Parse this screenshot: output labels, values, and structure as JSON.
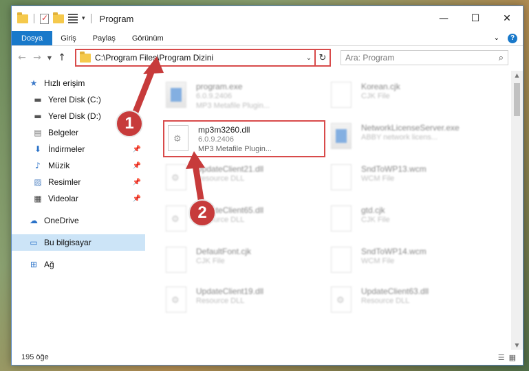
{
  "window": {
    "title": "Program",
    "min_icon": "minimize-icon",
    "max_icon": "maximize-icon",
    "close_icon": "close-icon"
  },
  "ribbon": {
    "tabs": [
      "Dosya",
      "Giriş",
      "Paylaş",
      "Görünüm"
    ],
    "active_tab": "Dosya"
  },
  "address": {
    "path": "C:\\Program Files\\Program Dizini",
    "search_placeholder": "Ara: Program"
  },
  "nav": {
    "quick_access": "Hızlı erişim",
    "items": [
      {
        "label": "Yerel Disk (C:)",
        "icon": "drive-icon",
        "pinned": false
      },
      {
        "label": "Yerel Disk (D:)",
        "icon": "drive-icon",
        "pinned": false
      },
      {
        "label": "Belgeler",
        "icon": "documents-icon",
        "pinned": false
      },
      {
        "label": "İndirmeler",
        "icon": "downloads-icon",
        "pinned": true
      },
      {
        "label": "Müzik",
        "icon": "music-icon",
        "pinned": true
      },
      {
        "label": "Resimler",
        "icon": "pictures-icon",
        "pinned": true
      },
      {
        "label": "Videolar",
        "icon": "videos-icon",
        "pinned": true
      }
    ],
    "onedrive": "OneDrive",
    "this_pc": "Bu bilgisayar",
    "network": "Ağ"
  },
  "files": [
    {
      "name": "program.exe",
      "line1": "6.0.9.2406",
      "line2": "MP3 Metafile Plugin..."
    },
    {
      "name": "Korean.cjk",
      "line1": "CJK File",
      "line2": ""
    },
    {
      "name": "mp3m3260.dll",
      "line1": "6.0.9.2406",
      "line2": "MP3 Metafile Plugin..."
    },
    {
      "name": "NetworkLicenseServer.exe",
      "line1": "ABBY network licens...",
      "line2": ""
    },
    {
      "name": "UpdateClient21.dll",
      "line1": "Resource DLL",
      "line2": ""
    },
    {
      "name": "SndToWP13.wcm",
      "line1": "WCM File",
      "line2": ""
    },
    {
      "name": "UpdateClient65.dll",
      "line1": "Resource DLL",
      "line2": ""
    },
    {
      "name": "gtd.cjk",
      "line1": "CJK File",
      "line2": ""
    },
    {
      "name": "DefaultFont.cjk",
      "line1": "CJK File",
      "line2": ""
    },
    {
      "name": "SndToWP14.wcm",
      "line1": "WCM File",
      "line2": ""
    },
    {
      "name": "UpdateClient19.dll",
      "line1": "Resource DLL",
      "line2": ""
    },
    {
      "name": "UpdateClient63.dll",
      "line1": "Resource DLL",
      "line2": ""
    }
  ],
  "status": {
    "count": "195 öğe"
  },
  "annotations": {
    "badge1": "1",
    "badge2": "2",
    "color": "#c73b3b"
  }
}
